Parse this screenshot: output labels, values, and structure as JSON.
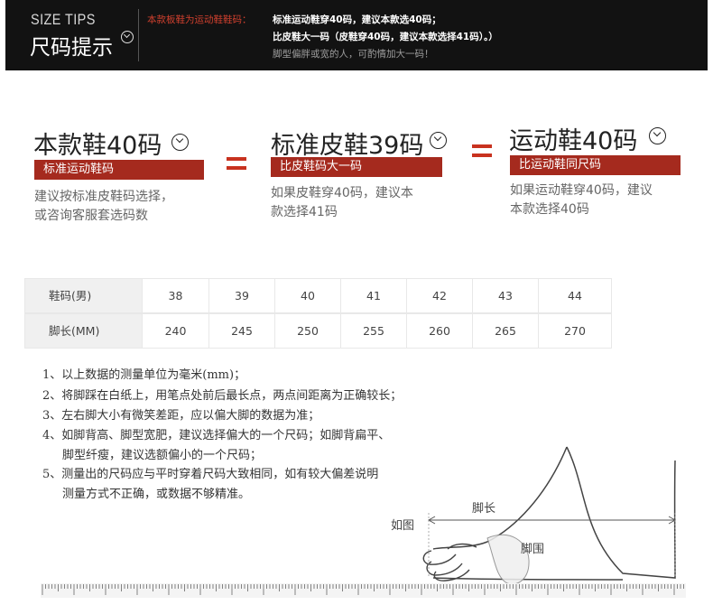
{
  "header": {
    "title_en": "SIZE TIPS",
    "title_cn": "尺码提示",
    "note_label": "本款板鞋为运动鞋鞋码：",
    "note_line1": "标准运动鞋穿40码，建议本款选40码；",
    "note_line2": "比皮鞋大一码（皮鞋穿40码，建议本款选择41码）。）",
    "note_line3": "脚型偏胖或宽的人，可酌情加大一码！"
  },
  "comparison": [
    {
      "title": "本款鞋40码",
      "bar": "标准运动鞋码",
      "desc": [
        "建议按标准皮鞋码选择，",
        "或咨询客服套选码数"
      ]
    },
    {
      "title": "标准皮鞋39码",
      "bar": "比皮鞋码大一码",
      "desc": [
        "如果皮鞋穿40码，建议本",
        "款选择41码"
      ]
    },
    {
      "title": "运动鞋40码",
      "bar": "比运动鞋同尺码",
      "desc": [
        "如果运动鞋穿40码，建议",
        "本款选择40码"
      ]
    }
  ],
  "colors": {
    "accent_red": "#a52a1e",
    "equals_red": "#c8321f",
    "header_bg": "#121212"
  },
  "size_table": {
    "headers": [
      "鞋码(男)",
      "脚长(MM)"
    ],
    "sizes": [
      "38",
      "39",
      "40",
      "41",
      "42",
      "43",
      "44"
    ],
    "lengths": [
      "240",
      "245",
      "250",
      "255",
      "260",
      "265",
      "270"
    ]
  },
  "notes": [
    "1、以上数据的测量单位为毫米(mm)；",
    "2、将脚踩在白纸上，用笔点处前后最长点，两点间距离为正确较长；",
    "3、左右脚大小有微笑差距，应以偏大脚的数据为准；",
    "4、如脚背高、脚型宽肥，建议选择偏大的一个尺码；如脚背扁平、",
    "脚型纤瘦，建议选额偏小的一个尺码；",
    "5、测量出的尺码应与平时穿着尺码大致相同，如有较大偏差说明",
    "测量方式不正确，或数据不够精准。"
  ],
  "diagram": {
    "example_label": "如图",
    "length_label": "脚长",
    "girth_label": "脚围"
  }
}
